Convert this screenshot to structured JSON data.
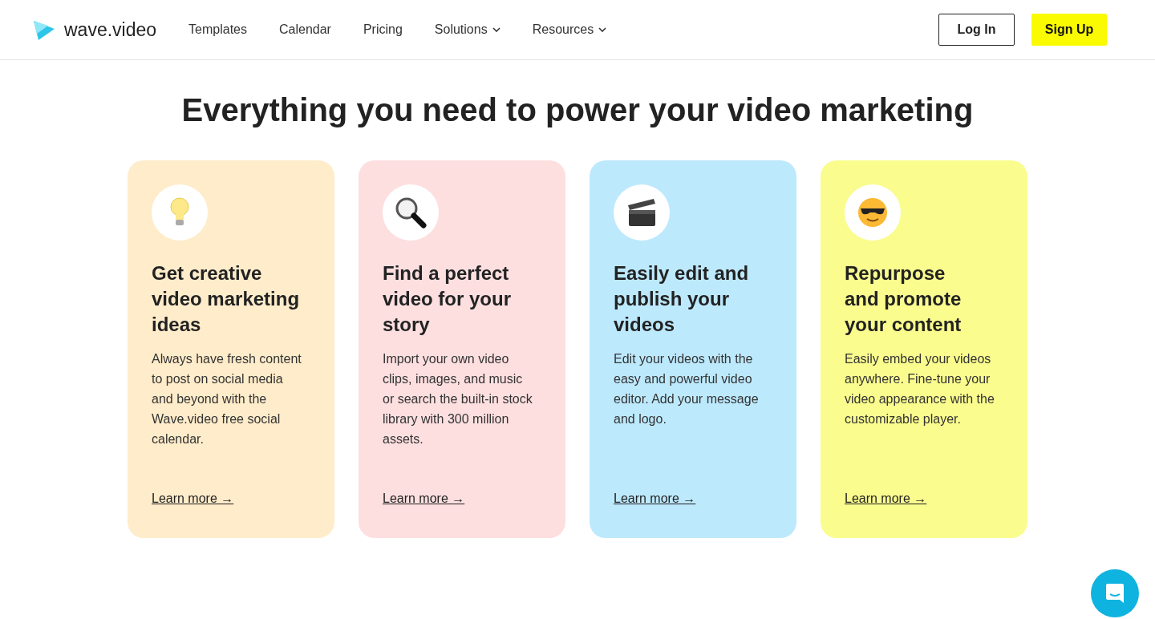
{
  "header": {
    "logo": "wave.video",
    "nav": [
      {
        "label": "Templates",
        "dropdown": false
      },
      {
        "label": "Calendar",
        "dropdown": false
      },
      {
        "label": "Pricing",
        "dropdown": false
      },
      {
        "label": "Solutions",
        "dropdown": true
      },
      {
        "label": "Resources",
        "dropdown": true
      }
    ],
    "login": "Log In",
    "signup": "Sign Up"
  },
  "heading": "Everything you need to power your video marketing",
  "cards": [
    {
      "kind": "bulb",
      "color": "#ffecca",
      "title_lines": [
        "Get creative",
        "video marketing",
        "ideas"
      ],
      "text": "Always have fresh content to post on social media and beyond with the Wave.video free social calendar.",
      "link": "Learn more →"
    },
    {
      "kind": "magnifier",
      "color": "#fddfe0",
      "title_lines": [
        "Find a perfect",
        "video for your",
        "story"
      ],
      "text": "Import your own video clips, images, and music or search the built-in stock library with 300 million assets.",
      "link": "Learn more →"
    },
    {
      "kind": "clapper",
      "color": "#bde9fd",
      "title_lines": [
        "Easily edit and",
        "publish your",
        "videos"
      ],
      "text": "Edit your videos with the easy and powerful video editor. Add your message and logo.",
      "link": "Learn more →"
    },
    {
      "kind": "sunglasses",
      "color": "#fafc8e",
      "title_lines": [
        "Repurpose",
        "and promote",
        "your content"
      ],
      "text": "Easily embed your videos anywhere. Fine-tune your video appearance with the customizable player.",
      "link": "Learn more →"
    }
  ]
}
